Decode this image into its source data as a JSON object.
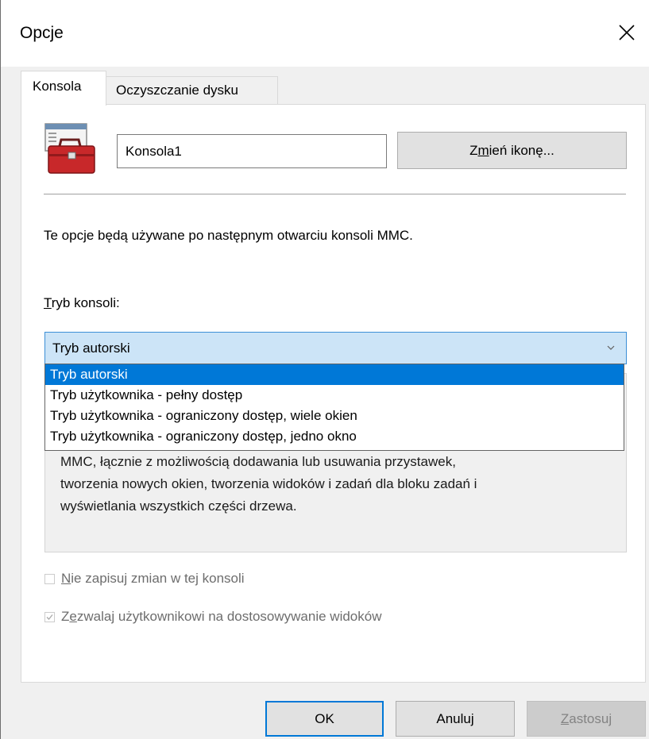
{
  "window": {
    "title": "Opcje"
  },
  "tabs": [
    {
      "label": "Konsola",
      "active": true
    },
    {
      "label": "Oczyszczanie dysku",
      "active": false
    }
  ],
  "console": {
    "name_value": "Konsola1",
    "change_icon_pre": "Z",
    "change_icon_mn": "m",
    "change_icon_post": "ień ikonę...",
    "info_text": "Te opcje będą używane po następnym otwarciu konsoli MMC.",
    "mode_label_mn": "T",
    "mode_label_post": "ryb konsoli:",
    "mode_selected": "Tryb autorski",
    "mode_options": [
      "Tryb autorski",
      "Tryb użytkownika - pełny dostęp",
      "Tryb użytkownika - ograniczony dostęp, wiele okien",
      "Tryb użytkownika - ograniczony dostęp, jedno okno"
    ],
    "description_visible": "MMC, łącznie z możliwością dodawania lub usuwania przystawek,\ntworzenia nowych okien, tworzenia widoków i zadań dla bloku zadań i\nwyświetlania wszystkich części drzewa.",
    "checkbox_no_save": {
      "mn": "N",
      "rest": "ie zapisuj zmian w tej konsoli",
      "checked": false
    },
    "checkbox_customize": {
      "pre": "Z",
      "mn": "e",
      "rest": "zwalaj użytkownikowi na dostosowywanie widoków",
      "checked": true
    }
  },
  "buttons": {
    "ok": "OK",
    "cancel": "Anuluj",
    "apply_mn": "Z",
    "apply_rest": "astosuj"
  },
  "icons": {
    "close": "close-icon",
    "app": "toolbox-icon",
    "dropdown": "chevron-down-icon",
    "check": "checkmark-icon"
  },
  "colors": {
    "accent": "#0078d7",
    "combo_bg": "#cce4f7"
  }
}
